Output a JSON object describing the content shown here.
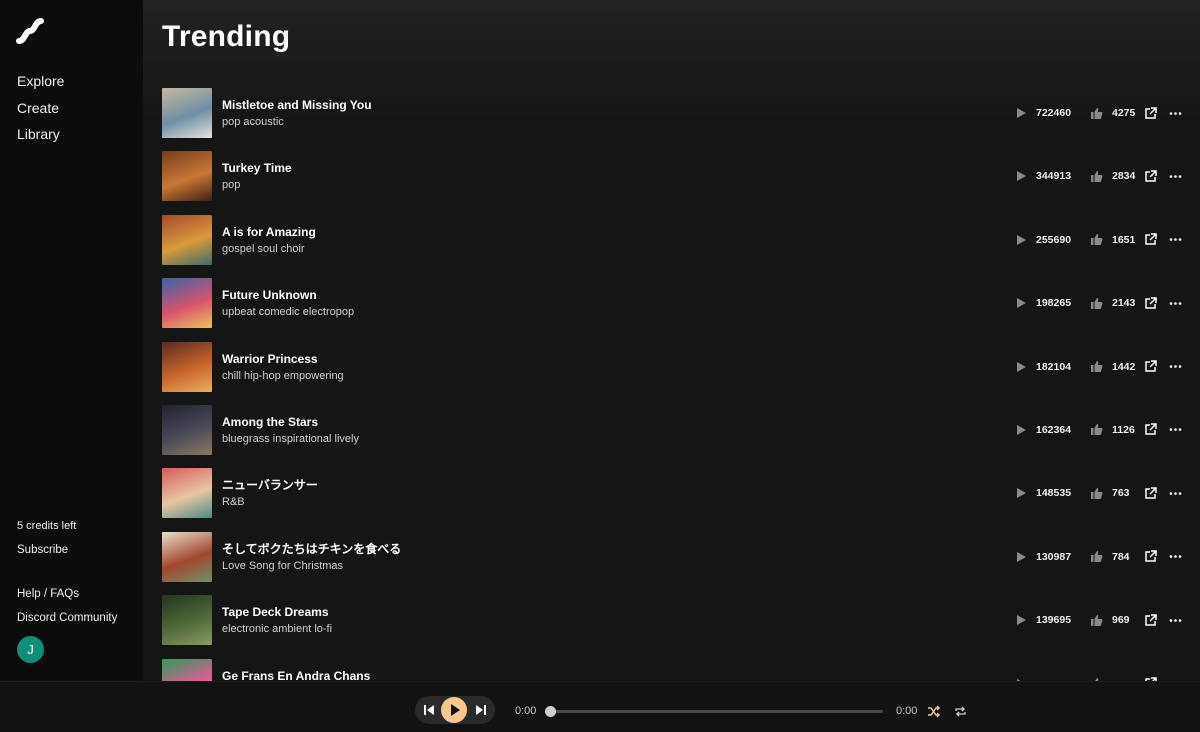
{
  "sidebar": {
    "nav": [
      "Explore",
      "Create",
      "Library"
    ],
    "credits": "5 credits left",
    "subscribe": "Subscribe",
    "help": "Help / FAQs",
    "discord": "Discord Community",
    "avatar": "J"
  },
  "page": {
    "title": "Trending"
  },
  "tracks": [
    {
      "title": "Mistletoe and Missing You",
      "style": "pop acoustic",
      "plays": "722460",
      "likes": "4275",
      "cover": [
        "#c9b7a0",
        "#6e8fa6",
        "#e8e4dc"
      ]
    },
    {
      "title": "Turkey Time",
      "style": "pop",
      "plays": "344913",
      "likes": "2834",
      "cover": [
        "#7a3b1e",
        "#c97836",
        "#3d2114"
      ]
    },
    {
      "title": "A is for Amazing",
      "style": "gospel soul choir",
      "plays": "255690",
      "likes": "1651",
      "cover": [
        "#a4482f",
        "#d99a3c",
        "#3f6a66"
      ]
    },
    {
      "title": "Future Unknown",
      "style": "upbeat comedic electropop",
      "plays": "198265",
      "likes": "2143",
      "cover": [
        "#3b62a8",
        "#d6546d",
        "#f0c060"
      ]
    },
    {
      "title": "Warrior Princess",
      "style": "chill hip-hop empowering",
      "plays": "182104",
      "likes": "1442",
      "cover": [
        "#5c2a1f",
        "#c9652c",
        "#e8b060"
      ]
    },
    {
      "title": "Among the Stars",
      "style": "bluegrass inspirational lively",
      "plays": "162364",
      "likes": "1126",
      "cover": [
        "#1f2230",
        "#4b4a5a",
        "#8c7a60"
      ]
    },
    {
      "title": "ニューバランサー",
      "style": "R&B",
      "plays": "148535",
      "likes": "763",
      "cover": [
        "#d75b5b",
        "#e8c6a2",
        "#4c8a8a"
      ]
    },
    {
      "title": "そしてボクたちはチキンを食べる",
      "style": "Love Song for Christmas",
      "plays": "130987",
      "likes": "784",
      "cover": [
        "#e9e0cc",
        "#a3472f",
        "#6f8f6c"
      ]
    },
    {
      "title": "Tape Deck Dreams",
      "style": "electronic ambient lo-fi",
      "plays": "139695",
      "likes": "969",
      "cover": [
        "#23351f",
        "#4e6a39",
        "#8e9a5f"
      ]
    },
    {
      "title": "Ge Frans En Andra Chans",
      "style": "",
      "plays": "",
      "likes": "",
      "cover": [
        "#2e9c5a",
        "#e35a9a",
        "#f3d23d"
      ]
    }
  ],
  "player": {
    "time_elapsed": "0:00",
    "time_total": "0:00",
    "progress": 0,
    "accent": "#f6c88f"
  },
  "icons": {
    "logo": "wave-logo-icon",
    "play": "play-icon",
    "like": "thumbs-up-icon",
    "share": "share-icon",
    "more": "more-icon",
    "prev": "skip-back-icon",
    "next": "skip-forward-icon",
    "shuffle": "shuffle-icon",
    "repeat": "repeat-icon"
  }
}
